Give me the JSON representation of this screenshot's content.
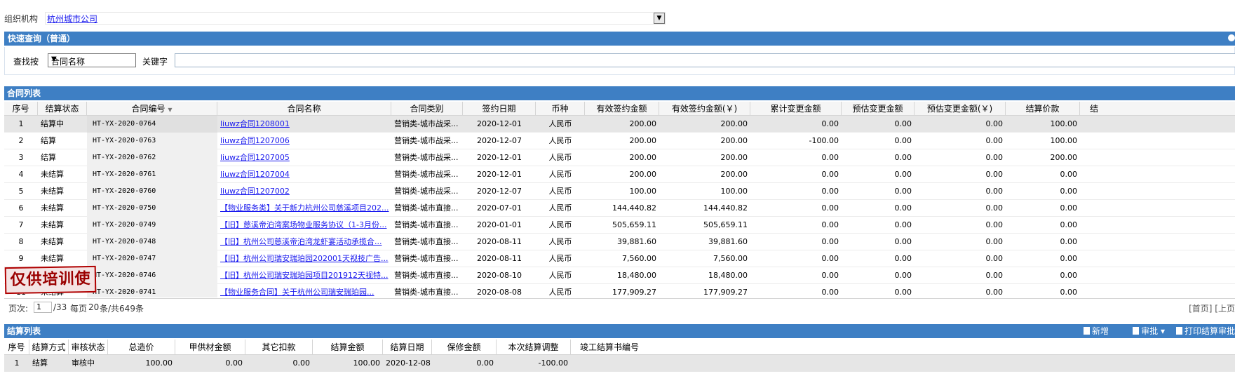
{
  "org": {
    "label": "组织机构",
    "value": "杭州城市公司",
    "dropdown_arrow": "▼"
  },
  "quick_query": {
    "title": "快速查询（普通）",
    "find_label": "查找按",
    "select_value": "合同名称",
    "select_arrow": "▼",
    "keyword_label": "关键字",
    "keyword_value": ""
  },
  "contract_list": {
    "title": "合同列表",
    "sort_indicator": "▼",
    "columns": [
      "序号",
      "结算状态",
      "合同编号",
      "合同名称",
      "合同类别",
      "签约日期",
      "币种",
      "有效签约金额",
      "有效签约金额(￥)",
      "累计变更金额",
      "预估变更金额",
      "预估变更金额(￥)",
      "结算价款",
      "结"
    ],
    "rows": [
      {
        "no": "1",
        "status": "结算中",
        "code": "HT-YX-2020-0764",
        "name": "liuwz合同1208001",
        "cat": "营销类-城市战采...",
        "date": "2020-12-01",
        "cur": "人民币",
        "amt": "200.00",
        "amt_y": "200.00",
        "chg": "0.00",
        "est": "0.00",
        "est_y": "0.00",
        "settle": "100.00"
      },
      {
        "no": "2",
        "status": "结算",
        "code": "HT-YX-2020-0763",
        "name": "liuwz合同1207006",
        "cat": "营销类-城市战采...",
        "date": "2020-12-07",
        "cur": "人民币",
        "amt": "200.00",
        "amt_y": "200.00",
        "chg": "-100.00",
        "est": "0.00",
        "est_y": "0.00",
        "settle": "100.00"
      },
      {
        "no": "3",
        "status": "结算",
        "code": "HT-YX-2020-0762",
        "name": "liuwz合同1207005",
        "cat": "营销类-城市战采...",
        "date": "2020-12-01",
        "cur": "人民币",
        "amt": "200.00",
        "amt_y": "200.00",
        "chg": "0.00",
        "est": "0.00",
        "est_y": "0.00",
        "settle": "200.00"
      },
      {
        "no": "4",
        "status": "未结算",
        "code": "HT-YX-2020-0761",
        "name": "liuwz合同1207004",
        "cat": "营销类-城市战采...",
        "date": "2020-12-01",
        "cur": "人民币",
        "amt": "200.00",
        "amt_y": "200.00",
        "chg": "0.00",
        "est": "0.00",
        "est_y": "0.00",
        "settle": "0.00"
      },
      {
        "no": "5",
        "status": "未结算",
        "code": "HT-YX-2020-0760",
        "name": "liuwz合同1207002",
        "cat": "营销类-城市战采...",
        "date": "2020-12-07",
        "cur": "人民币",
        "amt": "100.00",
        "amt_y": "100.00",
        "chg": "0.00",
        "est": "0.00",
        "est_y": "0.00",
        "settle": "0.00"
      },
      {
        "no": "6",
        "status": "未结算",
        "code": "HT-YX-2020-0750",
        "name": "【物业服务类】关于新力杭州公司慈溪项目202...",
        "cat": "营销类-城市直接...",
        "date": "2020-07-01",
        "cur": "人民币",
        "amt": "144,440.82",
        "amt_y": "144,440.82",
        "chg": "0.00",
        "est": "0.00",
        "est_y": "0.00",
        "settle": "0.00"
      },
      {
        "no": "7",
        "status": "未结算",
        "code": "HT-YX-2020-0749",
        "name": "【旧】慈溪帝泊湾案场物业服务协议（1-3月份...",
        "cat": "营销类-城市直接...",
        "date": "2020-01-01",
        "cur": "人民币",
        "amt": "505,659.11",
        "amt_y": "505,659.11",
        "chg": "0.00",
        "est": "0.00",
        "est_y": "0.00",
        "settle": "0.00"
      },
      {
        "no": "8",
        "status": "未结算",
        "code": "HT-YX-2020-0748",
        "name": "【旧】杭州公司慈溪帝泊湾龙虾宴活动承揽合...",
        "cat": "营销类-城市直接...",
        "date": "2020-08-11",
        "cur": "人民币",
        "amt": "39,881.60",
        "amt_y": "39,881.60",
        "chg": "0.00",
        "est": "0.00",
        "est_y": "0.00",
        "settle": "0.00"
      },
      {
        "no": "9",
        "status": "未结算",
        "code": "HT-YX-2020-0747",
        "name": "【旧】杭州公司瑞安瑞珀园202001天视技广告...",
        "cat": "营销类-城市直接...",
        "date": "2020-08-11",
        "cur": "人民币",
        "amt": "7,560.00",
        "amt_y": "7,560.00",
        "chg": "0.00",
        "est": "0.00",
        "est_y": "0.00",
        "settle": "0.00"
      },
      {
        "no": "10",
        "status": "未结算",
        "code": "HT-YX-2020-0746",
        "name": "【旧】杭州公司瑞安瑞珀园项目201912天视特...",
        "cat": "营销类-城市直接...",
        "date": "2020-08-10",
        "cur": "人民币",
        "amt": "18,480.00",
        "amt_y": "18,480.00",
        "chg": "0.00",
        "est": "0.00",
        "est_y": "0.00",
        "settle": "0.00"
      },
      {
        "no": "11",
        "status": "未结算",
        "code": "HT-YX-2020-0741",
        "name": "【物业服务合同】关于杭州公司瑞安瑞珀园...",
        "cat": "营销类-城市直接...",
        "date": "2020-08-08",
        "cur": "人民币",
        "amt": "177,909.27",
        "amt_y": "177,909.27",
        "chg": "0.00",
        "est": "0.00",
        "est_y": "0.00",
        "settle": "0.00"
      }
    ]
  },
  "watermark": {
    "text": "仅供培训使"
  },
  "pager": {
    "page_label": "页次:",
    "page_value": "1",
    "page_total": "/33",
    "per_page_label": "每页",
    "per_page_value": "20",
    "total_text": "条/共649条",
    "nav": "[首页] [上页"
  },
  "settlement_list": {
    "title": "结算列表",
    "tools": {
      "add": "新增",
      "approve": "审批",
      "approve_arrow": "▾",
      "print": "打印结算审批"
    },
    "columns": [
      "序号",
      "结算方式",
      "审核状态",
      "总造价",
      "甲供材金额",
      "其它扣款",
      "结算金额",
      "结算日期",
      "保修金额",
      "本次结算调整",
      "竣工结算书编号"
    ],
    "rows": [
      {
        "no": "1",
        "method": "结算",
        "state": "审核中",
        "total": "100.00",
        "supply": "0.00",
        "other": "0.00",
        "settle": "100.00",
        "date": "2020-12-08",
        "warranty": "0.00",
        "adjust": "-100.00",
        "book_no": ""
      }
    ]
  }
}
